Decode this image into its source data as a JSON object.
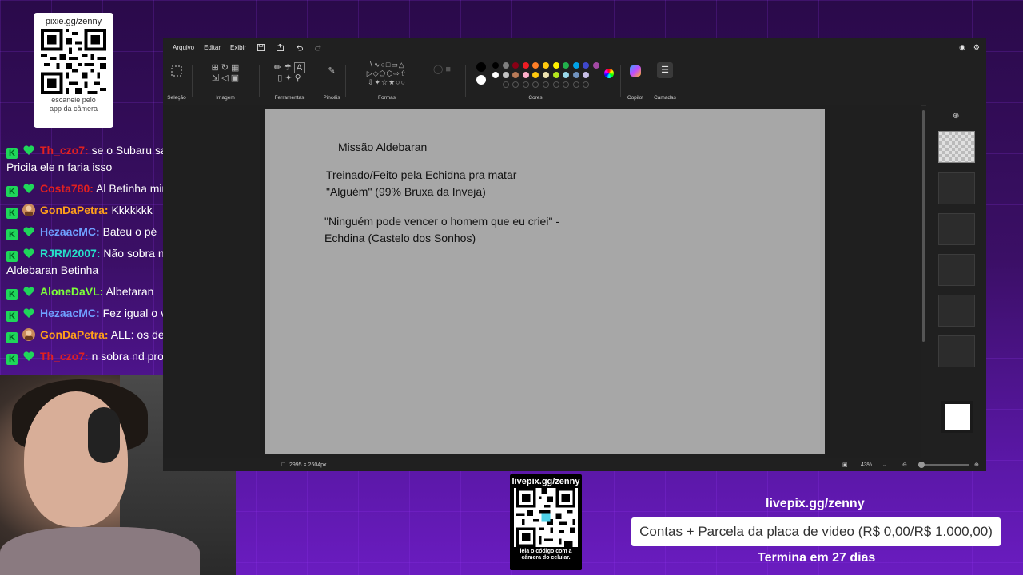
{
  "qr_top": {
    "title": "pixie.gg/zenny",
    "caption_line1": "escaneie pelo",
    "caption_line2": "app da câmera"
  },
  "chat": [
    {
      "user": "Th_czo7:",
      "text": "se o Subaru salvasse a Pricila ele n faria isso",
      "color": "#e02020",
      "badge": "heart"
    },
    {
      "user": "Costa780:",
      "text": "Al Betinha mimado",
      "color": "#e02020",
      "badge": "heart"
    },
    {
      "user": "GonDaPetra:",
      "text": "Kkkkkkk",
      "color": "#ff9f1a",
      "badge": "avatar"
    },
    {
      "user": "HezaacMC:",
      "text": "Bateu o pé",
      "color": "#6fa0ff",
      "badge": "heart"
    },
    {
      "user": "RJRM2007:",
      "text": "Não sobra nada pro Aldebaran Betinha",
      "color": "#26e0c8",
      "badge": "heart"
    },
    {
      "user": "AloneDaVL:",
      "text": "Albetaran",
      "color": "#7dff3a",
      "badge": "heart"
    },
    {
      "user": "HezaacMC:",
      "text": "Fez igual o vini jr",
      "color": "#6fa0ff",
      "badge": "heart"
    },
    {
      "user": "GonDaPetra:",
      "text": "ALL: os de verdade",
      "color": "#ff9f1a",
      "badge": "avatar"
    },
    {
      "user": "Th_czo7:",
      "text": "n sobra nd pro betinha",
      "color": "#e02020",
      "badge": "heart"
    }
  ],
  "paint": {
    "menu": {
      "file": "Arquivo",
      "edit": "Editar",
      "view": "Exibir"
    },
    "groups": {
      "selection": "Seleção",
      "image": "Imagem",
      "tools": "Ferramentas",
      "brushes": "Pincéis",
      "shapes": "Formas",
      "colors": "Cores",
      "copilot": "Copilot",
      "layers": "Camadas"
    },
    "canvas_text": {
      "title": "Missão Aldebaran",
      "line1": "Treinado/Feito pela Echidna pra matar",
      "line2": "\"Alguém\" (99% Bruxa da Inveja)",
      "line3": "\"Ninguém pode vencer o homem que eu criei\" -",
      "line4": "Echdina (Castelo dos Sonhos)"
    },
    "status": {
      "dimensions": "2995 × 2604px",
      "zoom": "43%"
    },
    "palette_top": [
      "#000000",
      "#7f7f7f",
      "#880015",
      "#ed1c24",
      "#ff7f27",
      "#ffc90e",
      "#fff200",
      "#22b14c",
      "#00a2e8",
      "#3f48cc",
      "#a349a4"
    ],
    "palette_mid": [
      "#ffffff",
      "#c3c3c3",
      "#b97a57",
      "#ffaec9",
      "#ffc90e",
      "#efe4b0",
      "#b5e61d",
      "#99d9ea",
      "#7092be",
      "#c8bfe7"
    ]
  },
  "qr_bottom": {
    "title": "livepix.gg/zenny",
    "caption": "leia o código com a câmera do celular."
  },
  "livepix": {
    "url": "livepix.gg/zenny",
    "goal": "Contas + Parcela da placa de video (R$ 0,00/R$ 1.000,00)",
    "remaining": "Termina em 27 dias"
  }
}
